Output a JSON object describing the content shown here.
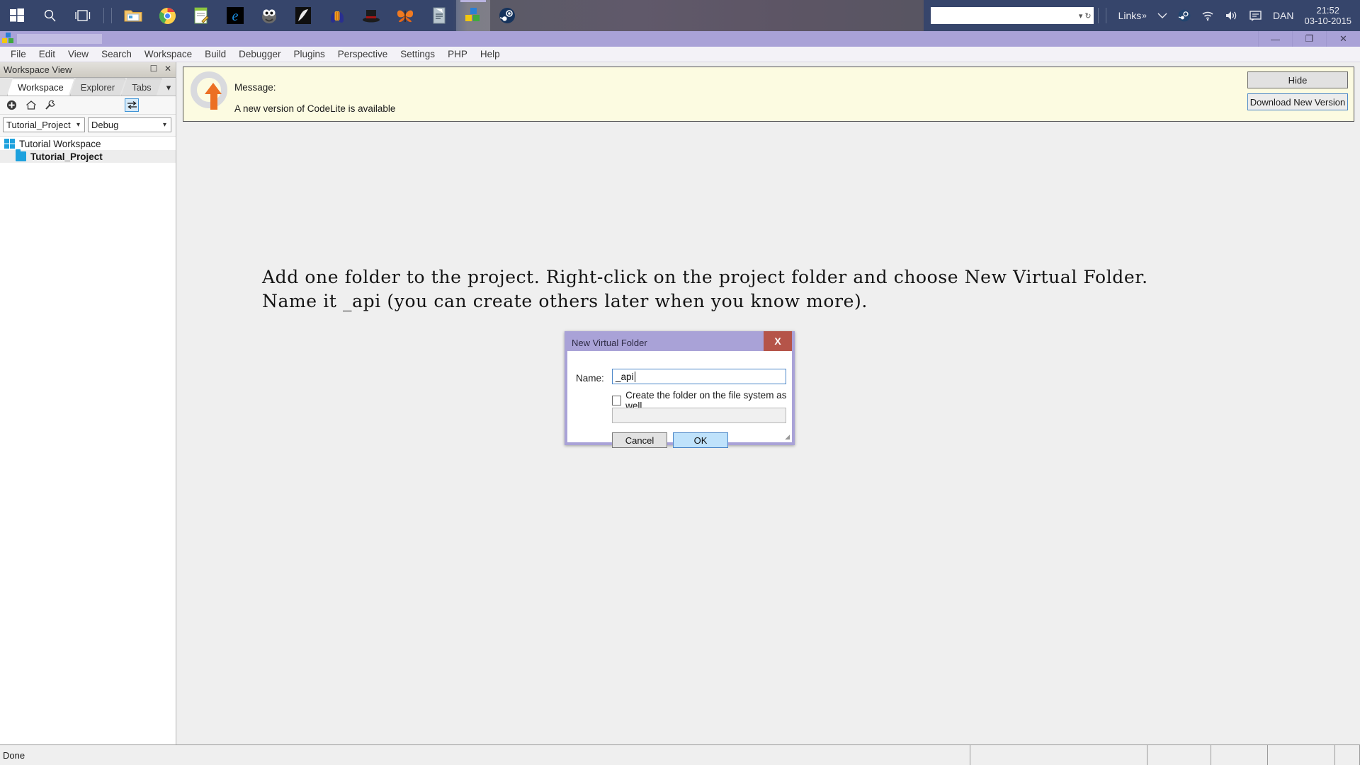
{
  "taskbar": {
    "start_icon": "windows-logo-icon",
    "search_icon": "search-icon",
    "taskview_icon": "task-view-icon",
    "apps": [
      {
        "name": "file-explorer-icon",
        "label": "File Explorer"
      },
      {
        "name": "google-chrome-icon",
        "label": "Google Chrome"
      },
      {
        "name": "notepad-plus-icon",
        "label": "Notepad"
      },
      {
        "name": "internet-explorer-icon",
        "label": "Internet Explorer"
      },
      {
        "name": "gimp-icon",
        "label": "GIMP"
      },
      {
        "name": "inkscape-icon",
        "label": "Inkscape"
      },
      {
        "name": "audacity-icon",
        "label": "Audacity"
      },
      {
        "name": "tophat-icon",
        "label": "Top Hat"
      },
      {
        "name": "butterfly-icon",
        "label": "Butterfly"
      },
      {
        "name": "document-editor-icon",
        "label": "Editor"
      },
      {
        "name": "codelite-icon",
        "label": "CodeLite"
      },
      {
        "name": "steam-icon",
        "label": "Steam"
      }
    ],
    "tray": {
      "search_placeholder": "",
      "links_label": "Links",
      "links_overflow": "»",
      "chevron_icon": "chevron-up-icon",
      "steam_icon": "steam-tray-icon",
      "network_icon": "wifi-icon",
      "volume_icon": "speaker-icon",
      "action_center_icon": "notifications-icon",
      "user_label": "DAN",
      "clock_time": "21:52",
      "clock_date": "03-10-2015"
    }
  },
  "window": {
    "titlebar": {
      "app_icon": "codelite-icon",
      "title": "",
      "minimize_label": "—",
      "maximize_label": "❐",
      "close_label": "✕"
    },
    "menu": [
      "File",
      "Edit",
      "View",
      "Search",
      "Workspace",
      "Build",
      "Debugger",
      "Plugins",
      "Perspective",
      "Settings",
      "PHP",
      "Help"
    ]
  },
  "workspace_panel": {
    "caption": "Workspace View",
    "float_icon": "restore-icon",
    "close_icon": "close-icon",
    "tabs": [
      {
        "label": "Workspace",
        "active": true
      },
      {
        "label": "Explorer",
        "active": false
      },
      {
        "label": "Tabs",
        "active": false
      }
    ],
    "tabs_more_icon": "chevron-down-icon",
    "toolbar": [
      {
        "name": "add-icon",
        "glyph": "⊕"
      },
      {
        "name": "home-icon",
        "glyph": "⌂"
      },
      {
        "name": "wrench-icon",
        "glyph": "🔧"
      }
    ],
    "swap_icon": "swap-arrows-icon",
    "project_selector": {
      "value": "Tutorial_Project",
      "arrow_icon": "chevron-down-icon"
    },
    "config_selector": {
      "value": "Debug",
      "arrow_icon": "chevron-down-icon"
    },
    "tree": [
      {
        "label": "Tutorial Workspace",
        "level": 1,
        "icon": "workspace-icon",
        "bold": false,
        "selected": false
      },
      {
        "label": "Tutorial_Project",
        "level": 2,
        "icon": "project-folder-icon",
        "bold": true,
        "selected": true
      }
    ]
  },
  "message_bar": {
    "icon": "update-gear-icon",
    "heading": "Message:",
    "text": "A new version of CodeLite is available",
    "hide_button": "Hide",
    "download_button": "Download New Version"
  },
  "instruction": {
    "text": "Add one folder to the project. Right-click on the project folder and choose New Virtual Folder.\nName it _api (you can create others later when you know more)."
  },
  "dialog": {
    "title": "New Virtual Folder",
    "close_label": "X",
    "name_label": "Name:",
    "name_value": "_api",
    "checkbox_label": "Create the folder on the file system as well",
    "checkbox_checked": false,
    "path_value": "",
    "cancel_button": "Cancel",
    "ok_button": "OK",
    "resize_grip_icon": "resize-grip-icon",
    "accent_title_color": "#a9a2d7",
    "close_color": "#b55449",
    "ok_color": "#bfe2fb"
  },
  "statusbar": {
    "message": "Done",
    "cells": [
      "",
      "",
      "",
      "",
      "",
      ""
    ]
  }
}
